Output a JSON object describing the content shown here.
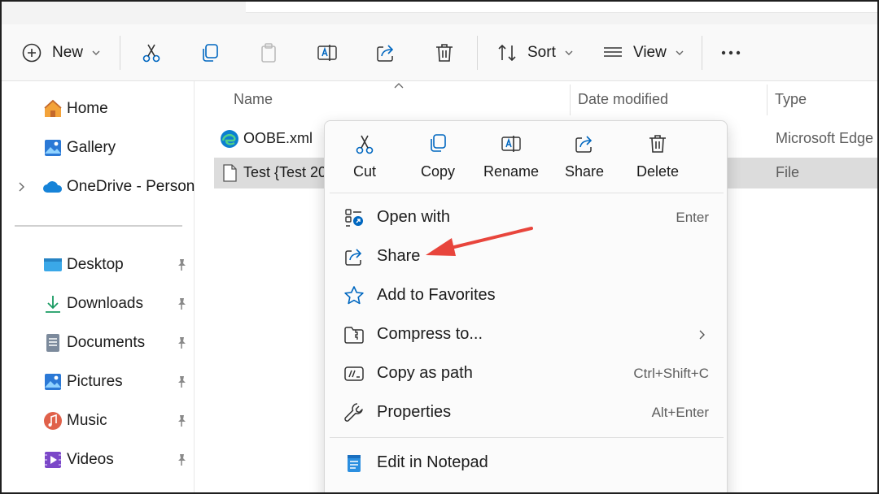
{
  "toolbar": {
    "new_label": "New",
    "sort_label": "Sort",
    "view_label": "View"
  },
  "sidebar": {
    "home": "Home",
    "gallery": "Gallery",
    "onedrive": "OneDrive - Persona",
    "quick": [
      {
        "label": "Desktop",
        "icon": "desktop-folder-icon"
      },
      {
        "label": "Downloads",
        "icon": "downloads-icon"
      },
      {
        "label": "Documents",
        "icon": "documents-icon"
      },
      {
        "label": "Pictures",
        "icon": "pictures-icon"
      },
      {
        "label": "Music",
        "icon": "music-icon"
      },
      {
        "label": "Videos",
        "icon": "videos-icon"
      }
    ]
  },
  "columns": {
    "name": "Name",
    "date": "Date modified",
    "type": "Type"
  },
  "files": [
    {
      "name": "OOBE.xml",
      "type": "Microsoft Edge",
      "icon": "edge-icon"
    },
    {
      "name": "Test {Test 20",
      "type": "File",
      "icon": "file-icon"
    }
  ],
  "context_menu": {
    "quick_actions": {
      "cut": "Cut",
      "copy": "Copy",
      "rename": "Rename",
      "share": "Share",
      "delete": "Delete"
    },
    "items": [
      {
        "label": "Open with",
        "shortcut": "Enter"
      },
      {
        "label": "Share",
        "shortcut": ""
      },
      {
        "label": "Add to Favorites",
        "shortcut": ""
      },
      {
        "label": "Compress to...",
        "shortcut": ""
      },
      {
        "label": "Copy as path",
        "shortcut": "Ctrl+Shift+C"
      },
      {
        "label": "Properties",
        "shortcut": "Alt+Enter"
      },
      {
        "label": "Edit in Notepad",
        "shortcut": ""
      }
    ]
  },
  "colors": {
    "accent": "#0067c0",
    "annotation_arrow": "#e8453c",
    "selection": "#dcdcdc"
  }
}
